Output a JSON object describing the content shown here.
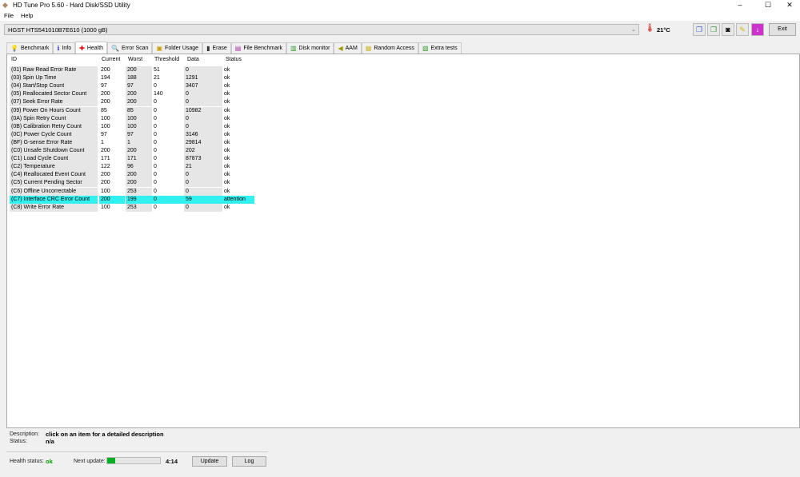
{
  "window": {
    "title": "HD Tune Pro 5.60 - Hard Disk/SSD Utility",
    "minimize": "–",
    "maximize": "☐",
    "close": "✕"
  },
  "menu": [
    "File",
    "Help"
  ],
  "drive": {
    "selected": "HGST HTS541010B7E610 (1000 gB)",
    "temperature": "21°C"
  },
  "toolbar": {
    "exit": "Exit"
  },
  "tabs": [
    {
      "label": "Benchmark",
      "icon": "💡"
    },
    {
      "label": "Info",
      "icon": "ℹ"
    },
    {
      "label": "Health",
      "icon": "✚"
    },
    {
      "label": "Error Scan",
      "icon": "🔍"
    },
    {
      "label": "Folder Usage",
      "icon": "▣"
    },
    {
      "label": "Erase",
      "icon": "▮"
    },
    {
      "label": "File Benchmark",
      "icon": "▤"
    },
    {
      "label": "Disk monitor",
      "icon": "▥"
    },
    {
      "label": "AAM",
      "icon": "◀"
    },
    {
      "label": "Random Access",
      "icon": "▦"
    },
    {
      "label": "Extra tests",
      "icon": "▧"
    }
  ],
  "table": {
    "columns": [
      "ID",
      "Current",
      "Worst",
      "Threshold",
      "Data",
      "Status"
    ],
    "rows": [
      [
        "(01) Raw Read Error Rate",
        "200",
        "200",
        "51",
        "0",
        "ok"
      ],
      [
        "(03) Spin Up Time",
        "194",
        "188",
        "21",
        "1291",
        "ok"
      ],
      [
        "(04) Start/Stop Count",
        "97",
        "97",
        "0",
        "3407",
        "ok"
      ],
      [
        "(05) Reallocated Sector Count",
        "200",
        "200",
        "140",
        "0",
        "ok"
      ],
      [
        "(07) Seek Error Rate",
        "200",
        "200",
        "0",
        "0",
        "ok"
      ],
      [
        "(09) Power On Hours Count",
        "85",
        "85",
        "0",
        "10982",
        "ok"
      ],
      [
        "(0A) Spin Retry Count",
        "100",
        "100",
        "0",
        "0",
        "ok"
      ],
      [
        "(0B) Calibration Retry Count",
        "100",
        "100",
        "0",
        "0",
        "ok"
      ],
      [
        "(0C) Power Cycle Count",
        "97",
        "97",
        "0",
        "3146",
        "ok"
      ],
      [
        "(BF) G-sense Error Rate",
        "1",
        "1",
        "0",
        "29814",
        "ok"
      ],
      [
        "(C0) Unsafe Shutdown Count",
        "200",
        "200",
        "0",
        "202",
        "ok"
      ],
      [
        "(C1) Load Cycle Count",
        "171",
        "171",
        "0",
        "87873",
        "ok"
      ],
      [
        "(C2) Temperature",
        "122",
        "96",
        "0",
        "21",
        "ok"
      ],
      [
        "(C4) Reallocated Event Count",
        "200",
        "200",
        "0",
        "0",
        "ok"
      ],
      [
        "(C5) Current Pending Sector",
        "200",
        "200",
        "0",
        "0",
        "ok"
      ],
      [
        "(C6) Offline Uncorrectable",
        "100",
        "253",
        "0",
        "0",
        "ok"
      ],
      [
        "(C7) Interface CRC Error Count",
        "200",
        "199",
        "0",
        "59",
        "attention"
      ],
      [
        "(C8) Write Error Rate",
        "100",
        "253",
        "0",
        "0",
        "ok"
      ]
    ],
    "selected_row": 16
  },
  "details": {
    "description_label": "Description:",
    "description": "click on an item for a detailed description",
    "status_label": "Status:",
    "status": "n/a"
  },
  "footer": {
    "health_label": "Health status:",
    "health": "ok",
    "next_update_label": "Next update:",
    "progress_percent": 15,
    "countdown": "4:14",
    "update": "Update",
    "log": "Log"
  },
  "colors": {
    "ok": "#00a000",
    "progress": "#06b025",
    "selected": "#33f0f0"
  }
}
